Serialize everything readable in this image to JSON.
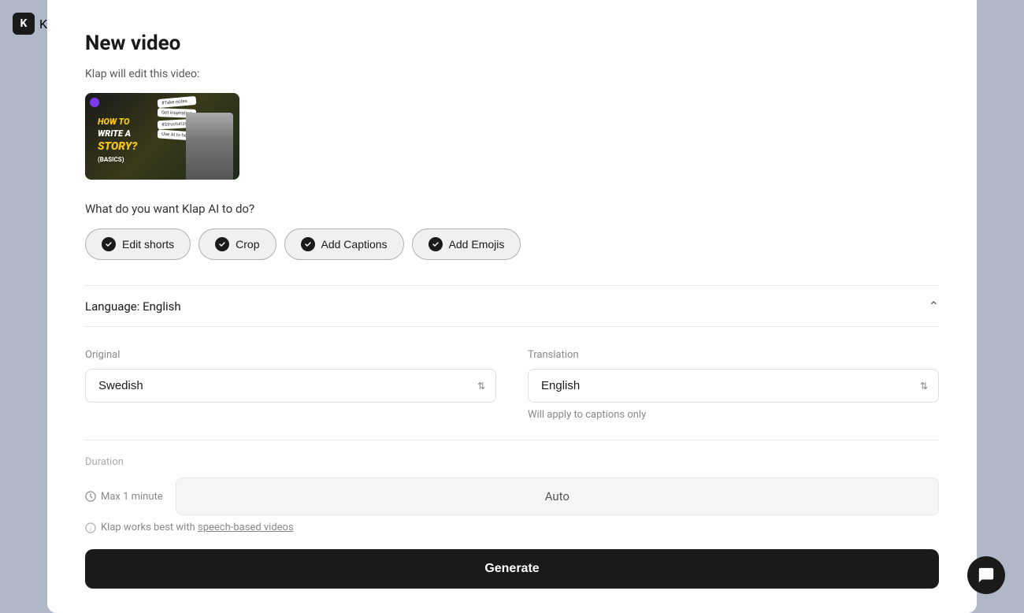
{
  "app": {
    "logo_letter": "K",
    "logo_text": "K"
  },
  "modal": {
    "title": "New video",
    "subtitle": "Klap will edit this video:",
    "action_question": "What do you want Klap AI to do?"
  },
  "toggle_buttons": [
    {
      "id": "edit-shorts",
      "label": "Edit shorts",
      "active": true
    },
    {
      "id": "crop",
      "label": "Crop",
      "active": true
    },
    {
      "id": "add-captions",
      "label": "Add Captions",
      "active": true
    },
    {
      "id": "add-emojis",
      "label": "Add Emojis",
      "active": true
    }
  ],
  "language": {
    "header_label": "Language: English",
    "original_label": "Original",
    "original_value": "Swedish",
    "translation_label": "Translation",
    "translation_value": "English",
    "caption_note": "Will apply to captions only"
  },
  "duration": {
    "label": "Duration",
    "max_label": "Max 1 minute",
    "auto_value": "Auto"
  },
  "klap_note": "Klap works best with speech-based videos",
  "generate_button": "Generate",
  "thumbnail": {
    "notes": [
      "#Take notes",
      "Get inspiration",
      "#Structurize",
      "Use AI to help"
    ]
  }
}
